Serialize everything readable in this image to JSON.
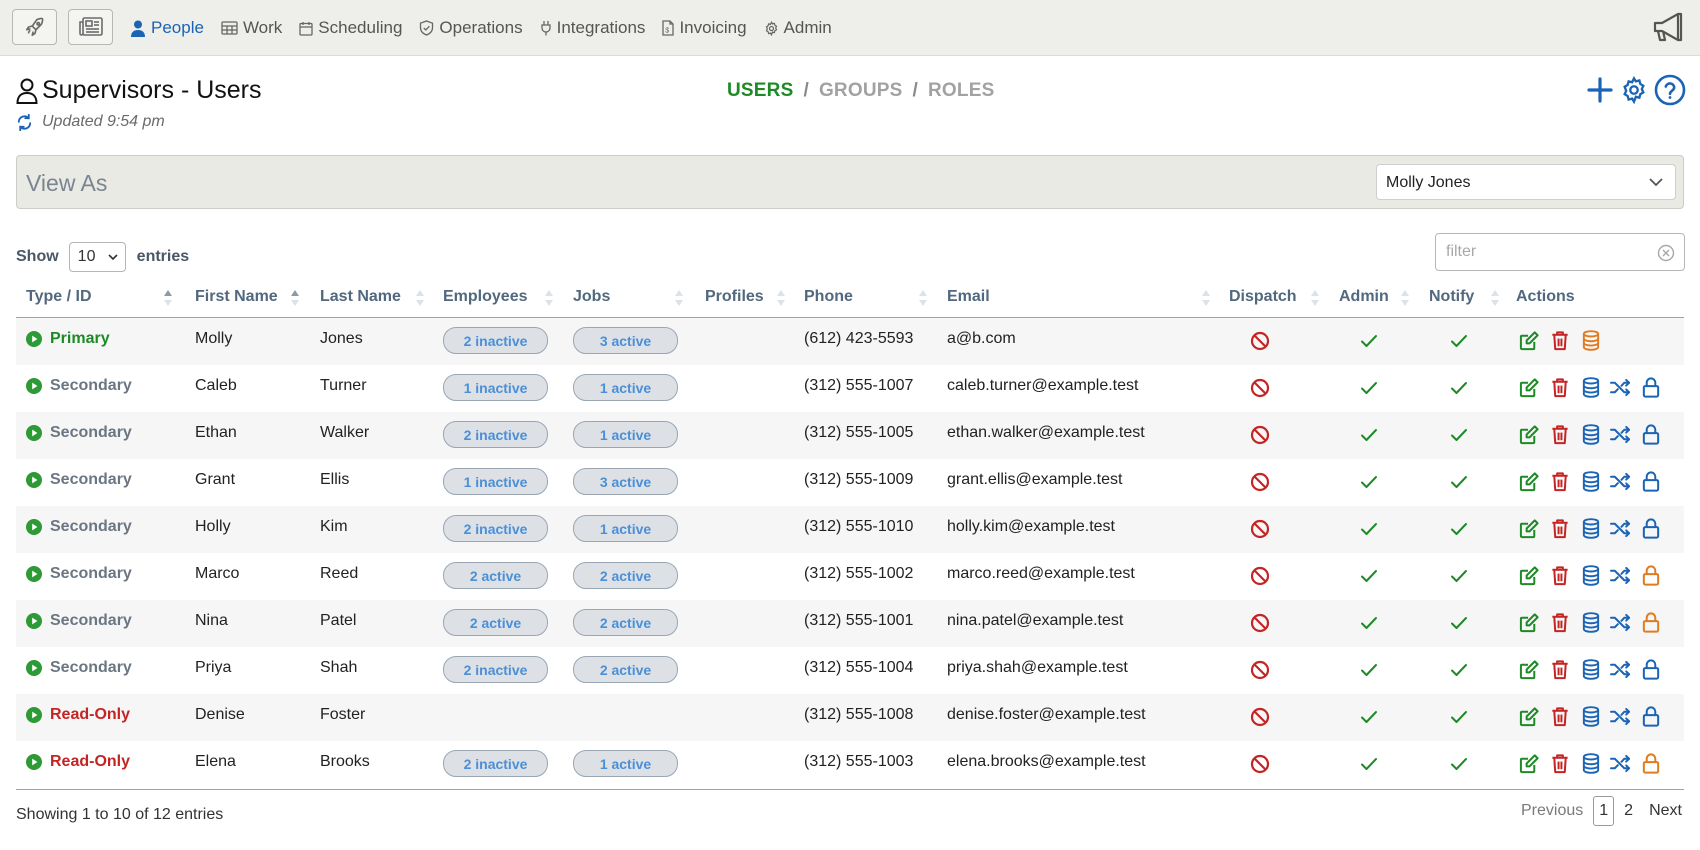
{
  "colors": {
    "accent_blue": "#1b64b5",
    "green": "#1e8a26",
    "red": "#c42524",
    "orange": "#e07b1f",
    "muted_gray": "#a2a2a2"
  },
  "nav": {
    "left_buttons": [
      {
        "icon": "rocket-icon"
      },
      {
        "icon": "newspaper-icon"
      }
    ],
    "items": [
      {
        "label": "People",
        "icon": "person-icon",
        "active": true
      },
      {
        "label": "Work",
        "icon": "kanban-icon",
        "active": false
      },
      {
        "label": "Scheduling",
        "icon": "calendar-icon",
        "active": false
      },
      {
        "label": "Operations",
        "icon": "shield-icon",
        "active": false
      },
      {
        "label": "Integrations",
        "icon": "plug-icon",
        "active": false
      },
      {
        "label": "Invoicing",
        "icon": "invoice-icon",
        "active": false
      },
      {
        "label": "Admin",
        "icon": "gear-icon",
        "active": false
      }
    ],
    "right_icon": "megaphone-icon"
  },
  "header": {
    "title": "Supervisors - Users",
    "updated": "Updated 9:54 pm",
    "tabs": [
      {
        "label": "USERS",
        "active": true
      },
      {
        "label": "GROUPS",
        "active": false
      },
      {
        "label": "ROLES",
        "active": false
      }
    ],
    "separator": "/",
    "actions": [
      "add-icon",
      "settings-icon",
      "help-icon"
    ]
  },
  "view_as": {
    "label": "View As",
    "selected": "Molly Jones"
  },
  "controls": {
    "show_label": "Show",
    "entries_value": "10",
    "entries_label": "entries",
    "filter_placeholder": "filter"
  },
  "table": {
    "columns": [
      "Type / ID",
      "First Name",
      "Last Name",
      "Employees",
      "Jobs",
      "Profiles",
      "Phone",
      "Email",
      "Dispatch",
      "Admin",
      "Notify",
      "Actions"
    ],
    "rows": [
      {
        "type": "Primary",
        "first": "Molly",
        "last": "Jones",
        "employees": "2 inactive",
        "jobs": "3 active",
        "profiles": "",
        "phone": "(612) 423-5593",
        "email": "a@b.com",
        "dispatch": false,
        "admin": true,
        "notify": true,
        "actions": [
          "edit",
          "delete",
          "database"
        ],
        "database_color": "orange",
        "lock": null
      },
      {
        "type": "Secondary",
        "first": "Caleb",
        "last": "Turner",
        "employees": "1 inactive",
        "jobs": "1 active",
        "profiles": "",
        "phone": "(312) 555-1007",
        "email": "caleb.turner@example.test",
        "dispatch": false,
        "admin": true,
        "notify": true,
        "actions": [
          "edit",
          "delete",
          "database",
          "shuffle",
          "lock"
        ],
        "database_color": "blue",
        "lock": "blue"
      },
      {
        "type": "Secondary",
        "first": "Ethan",
        "last": "Walker",
        "employees": "2 inactive",
        "jobs": "1 active",
        "profiles": "",
        "phone": "(312) 555-1005",
        "email": "ethan.walker@example.test",
        "dispatch": false,
        "admin": true,
        "notify": true,
        "actions": [
          "edit",
          "delete",
          "database",
          "shuffle",
          "lock"
        ],
        "database_color": "blue",
        "lock": "blue"
      },
      {
        "type": "Secondary",
        "first": "Grant",
        "last": "Ellis",
        "employees": "1 inactive",
        "jobs": "3 active",
        "profiles": "",
        "phone": "(312) 555-1009",
        "email": "grant.ellis@example.test",
        "dispatch": false,
        "admin": true,
        "notify": true,
        "actions": [
          "edit",
          "delete",
          "database",
          "shuffle",
          "lock"
        ],
        "database_color": "blue",
        "lock": "blue"
      },
      {
        "type": "Secondary",
        "first": "Holly",
        "last": "Kim",
        "employees": "2 inactive",
        "jobs": "1 active",
        "profiles": "",
        "phone": "(312) 555-1010",
        "email": "holly.kim@example.test",
        "dispatch": false,
        "admin": true,
        "notify": true,
        "actions": [
          "edit",
          "delete",
          "database",
          "shuffle",
          "lock"
        ],
        "database_color": "blue",
        "lock": "blue"
      },
      {
        "type": "Secondary",
        "first": "Marco",
        "last": "Reed",
        "employees": "2 active",
        "jobs": "2 active",
        "profiles": "",
        "phone": "(312) 555-1002",
        "email": "marco.reed@example.test",
        "dispatch": false,
        "admin": true,
        "notify": true,
        "actions": [
          "edit",
          "delete",
          "database",
          "shuffle",
          "lock"
        ],
        "database_color": "blue",
        "lock": "orange"
      },
      {
        "type": "Secondary",
        "first": "Nina",
        "last": "Patel",
        "employees": "2 active",
        "jobs": "2 active",
        "profiles": "",
        "phone": "(312) 555-1001",
        "email": "nina.patel@example.test",
        "dispatch": false,
        "admin": true,
        "notify": true,
        "actions": [
          "edit",
          "delete",
          "database",
          "shuffle",
          "lock"
        ],
        "database_color": "blue",
        "lock": "orange"
      },
      {
        "type": "Secondary",
        "first": "Priya",
        "last": "Shah",
        "employees": "2 inactive",
        "jobs": "2 active",
        "profiles": "",
        "phone": "(312) 555-1004",
        "email": "priya.shah@example.test",
        "dispatch": false,
        "admin": true,
        "notify": true,
        "actions": [
          "edit",
          "delete",
          "database",
          "shuffle",
          "lock"
        ],
        "database_color": "blue",
        "lock": "blue"
      },
      {
        "type": "Read-Only",
        "first": "Denise",
        "last": "Foster",
        "employees": "",
        "jobs": "",
        "profiles": "",
        "phone": "(312) 555-1008",
        "email": "denise.foster@example.test",
        "dispatch": false,
        "admin": true,
        "notify": true,
        "actions": [
          "edit",
          "delete",
          "database",
          "shuffle",
          "lock"
        ],
        "database_color": "blue",
        "lock": "blue"
      },
      {
        "type": "Read-Only",
        "first": "Elena",
        "last": "Brooks",
        "employees": "2 inactive",
        "jobs": "1 active",
        "profiles": "",
        "phone": "(312) 555-1003",
        "email": "elena.brooks@example.test",
        "dispatch": false,
        "admin": true,
        "notify": true,
        "actions": [
          "edit",
          "delete",
          "database",
          "shuffle",
          "lock"
        ],
        "database_color": "blue",
        "lock": "orange"
      }
    ]
  },
  "footer": {
    "info": "Showing 1 to 10 of 12 entries",
    "previous": "Previous",
    "pages": [
      "1",
      "2"
    ],
    "current_page": "1",
    "next": "Next"
  }
}
